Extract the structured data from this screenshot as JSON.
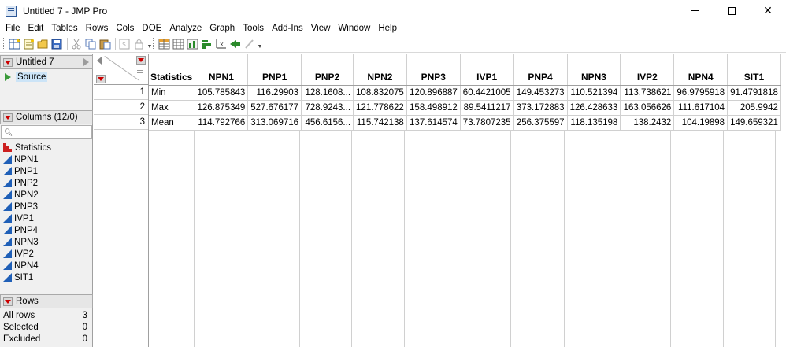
{
  "window": {
    "title": "Untitled 7 - JMP Pro",
    "icon": "jmp-app-icon",
    "controls": {
      "close_glyph": "✕"
    }
  },
  "menu": [
    "File",
    "Edit",
    "Tables",
    "Rows",
    "Cols",
    "DOE",
    "Analyze",
    "Graph",
    "Tools",
    "Add-Ins",
    "View",
    "Window",
    "Help"
  ],
  "toolbar": {
    "icons": [
      "new-data-table-icon",
      "new-script-icon",
      "open-icon",
      "save-icon",
      "cut-icon",
      "copy-icon",
      "paste-icon",
      "format-icon",
      "lock-icon",
      "data-grid-icon",
      "tabulate-icon",
      "distribution-icon",
      "graph-builder-icon",
      "fit-y-by-x-icon",
      "fit-model-icon",
      "pencil-icon"
    ]
  },
  "left_panel": {
    "table_name": "Untitled 7",
    "source_label": "Source",
    "columns_header": "Columns (12/0)",
    "search_placeholder": "",
    "columns": [
      "Statistics",
      "NPN1",
      "PNP1",
      "PNP2",
      "NPN2",
      "PNP3",
      "IVP1",
      "PNP4",
      "NPN3",
      "IVP2",
      "NPN4",
      "SIT1"
    ],
    "rows_header": "Rows",
    "rows_stats": [
      {
        "label": "All rows",
        "value": "3"
      },
      {
        "label": "Selected",
        "value": "0"
      },
      {
        "label": "Excluded",
        "value": "0"
      }
    ]
  },
  "grid": {
    "headers": [
      "Statistics",
      "NPN1",
      "PNP1",
      "PNP2",
      "NPN2",
      "PNP3",
      "IVP1",
      "PNP4",
      "NPN3",
      "IVP2",
      "NPN4",
      "SIT1"
    ],
    "rows": [
      {
        "num": "1",
        "cells": [
          "Min",
          "105.785843",
          "116.29903",
          "128.1608...",
          "108.832075",
          "120.896887",
          "60.4421005",
          "149.453273",
          "110.521394",
          "113.738621",
          "96.9795918",
          "91.4791818"
        ]
      },
      {
        "num": "2",
        "cells": [
          "Max",
          "126.875349",
          "527.676177",
          "728.9243...",
          "121.778622",
          "158.498912",
          "89.5411217",
          "373.172883",
          "126.428633",
          "163.056626",
          "111.617104",
          "205.9942"
        ]
      },
      {
        "num": "3",
        "cells": [
          "Mean",
          "114.792766",
          "313.069716",
          "456.6156...",
          "115.742138",
          "137.614574",
          "73.7807235",
          "256.375597",
          "118.135198",
          "138.2432",
          "104.19898",
          "149.659321"
        ]
      }
    ]
  },
  "colors": {
    "accent_red": "#cc0000",
    "selection": "#cce4f7",
    "continuous_icon": "#1f5fb7",
    "nominal_icon": "#cc2020"
  }
}
